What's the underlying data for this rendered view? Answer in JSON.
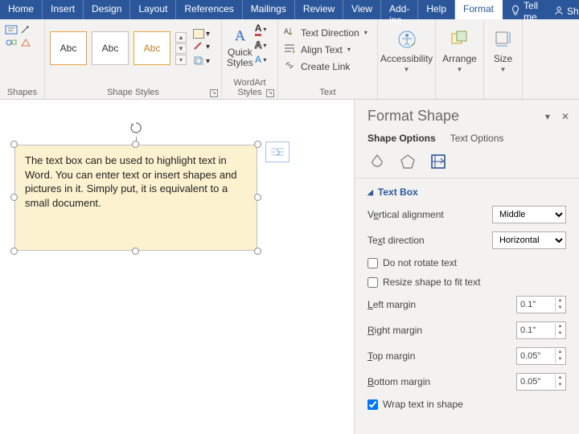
{
  "tabs": {
    "items": [
      "Home",
      "Insert",
      "Design",
      "Layout",
      "References",
      "Mailings",
      "Review",
      "View",
      "Add-ins",
      "Help",
      "Format"
    ],
    "active": "Format",
    "tell_me": "Tell me",
    "share": "Share"
  },
  "ribbon": {
    "shapes": {
      "label": "Shapes"
    },
    "shape_styles": {
      "label": "Shape Styles",
      "abc": "Abc",
      "fill_label": "Shape Fill",
      "outline_label": "Shape Outline",
      "effects_label": "Shape Effects"
    },
    "wordart": {
      "label": "WordArt Styles",
      "button": "Quick\nStyles"
    },
    "text": {
      "label": "Text",
      "direction": "Text Direction",
      "align": "Align Text",
      "link": "Create Link"
    },
    "accessibility": {
      "label": "Accessibility"
    },
    "arrange": {
      "label": "Arrange"
    },
    "size": {
      "label": "Size"
    }
  },
  "textbox": {
    "content": "The text box can be used to highlight text in Word. You can enter text or insert shapes and pictures in it. Simply put, it is equivalent to a small document."
  },
  "pane": {
    "title": "Format Shape",
    "tab_shape": "Shape Options",
    "tab_text": "Text Options",
    "section": "Text Box",
    "vertical_alignment": {
      "label_pre": "V",
      "label_ul": "e",
      "label_post": "rtical alignment",
      "value": "Middle"
    },
    "text_direction": {
      "label_pre": "Te",
      "label_ul": "x",
      "label_post": "t direction",
      "value": "Horizontal"
    },
    "do_not_rotate": {
      "label_ul": "D",
      "label_post": "o not rotate text",
      "checked": false
    },
    "resize_shape": {
      "label_pre": "Resize shape to ",
      "label_ul": "f",
      "label_post": "it text",
      "checked": false
    },
    "left_margin": {
      "label_ul": "L",
      "label_post": "eft margin",
      "value": "0.1\""
    },
    "right_margin": {
      "label_ul": "R",
      "label_post": "ight margin",
      "value": "0.1\""
    },
    "top_margin": {
      "label_ul": "T",
      "label_post": "op margin",
      "value": "0.05\""
    },
    "bottom_margin": {
      "label_ul": "B",
      "label_post": "ottom margin",
      "value": "0.05\""
    },
    "wrap": {
      "label_ul": "W",
      "label_post": "rap text in shape",
      "checked": true
    }
  }
}
